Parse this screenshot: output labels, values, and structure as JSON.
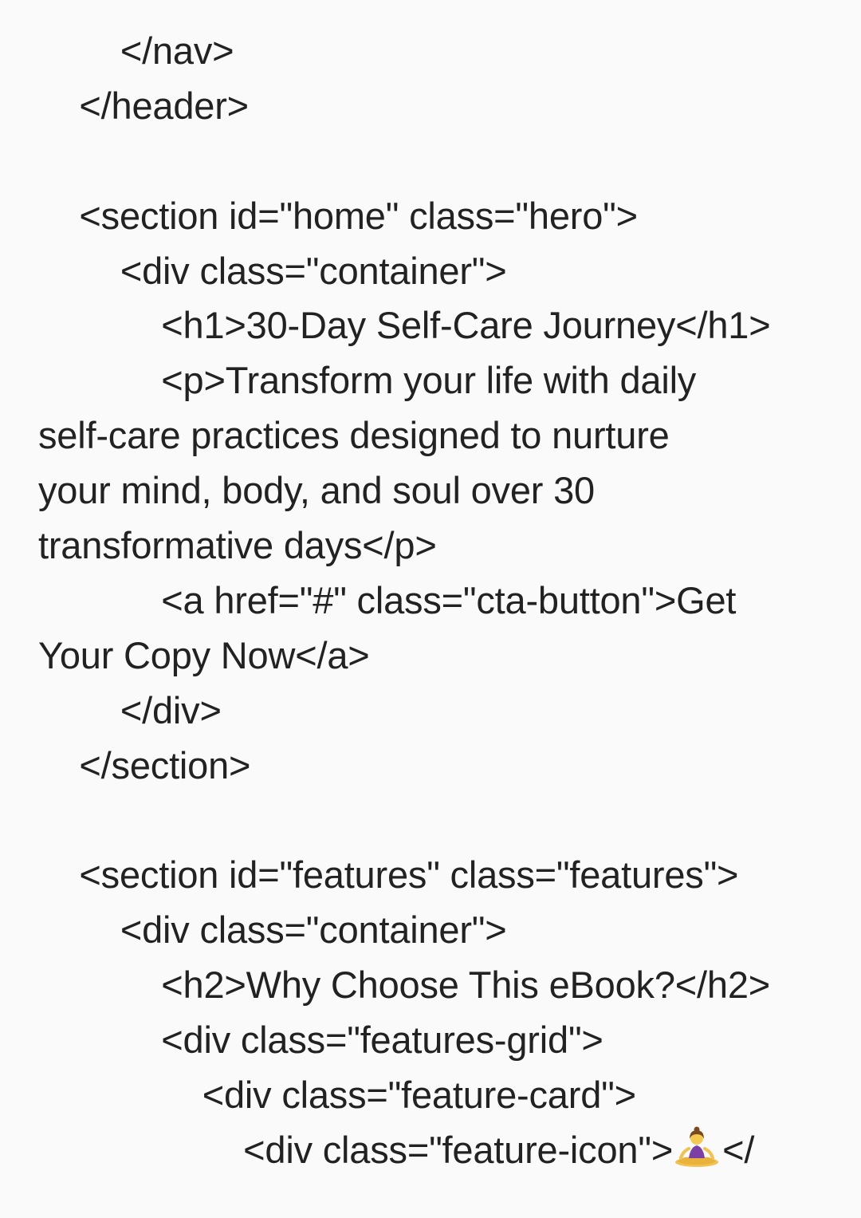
{
  "document": {
    "lines": [
      "        </nav>",
      "    </header>",
      "",
      "    <section id=\"home\" class=\"hero\">",
      "        <div class=\"container\">",
      "            <h1>30-Day Self-Care Journey</h1>",
      "            <p>Transform your life with daily",
      "self-care practices designed to nurture",
      "your mind, body, and soul over 30",
      "transformative days</p>",
      "            <a href=\"#\" class=\"cta-button\">Get",
      "Your Copy Now</a>",
      "        </div>",
      "    </section>",
      "",
      "    <section id=\"features\" class=\"features\">",
      "        <div class=\"container\">",
      "            <h2>Why Choose This eBook?</h2>",
      "            <div class=\"features-grid\">",
      "                <div class=\"feature-card\">"
    ],
    "last_line_prefix": "                    <div class=\"feature-icon\">",
    "last_line_emoji": "person-in-lotus-position-icon",
    "last_line_suffix": "</"
  }
}
